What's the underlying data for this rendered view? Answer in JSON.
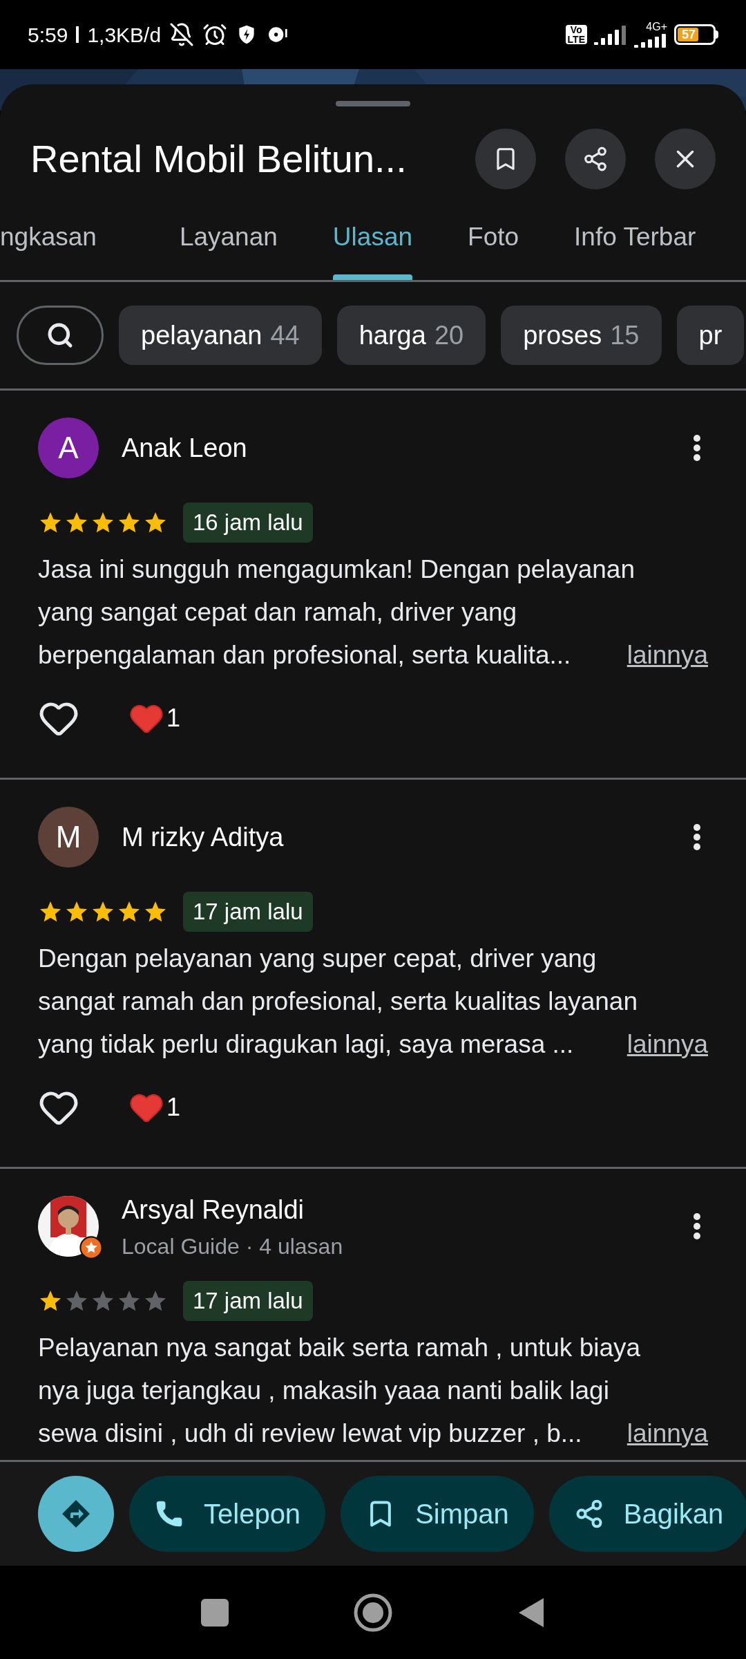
{
  "status_bar": {
    "time": "5:59",
    "speed": "1,3KB/d",
    "volte_top": "Vo",
    "volte_bottom": "LTE",
    "network": "4G+",
    "battery": "57"
  },
  "place": {
    "title": "Rental Mobil Belitun..."
  },
  "tabs": [
    {
      "label": "ngkasan",
      "selected": false
    },
    {
      "label": "Layanan",
      "selected": false
    },
    {
      "label": "Ulasan",
      "selected": true
    },
    {
      "label": "Foto",
      "selected": false
    },
    {
      "label": "Info Terbar",
      "selected": false
    }
  ],
  "filter_chips": [
    {
      "label": "pelayanan",
      "count": "44"
    },
    {
      "label": "harga",
      "count": "20"
    },
    {
      "label": "proses",
      "count": "15"
    },
    {
      "label": "pr"
    }
  ],
  "reviews": [
    {
      "avatar": {
        "kind": "letter",
        "letter": "A",
        "color": "#7b1fa2"
      },
      "name": "Anak Leon",
      "stars": 5,
      "time": "16 jam lalu",
      "lines": [
        "Jasa ini sungguh mengagumkan! Dengan pelayanan",
        "yang sangat cepat dan ramah, driver yang",
        "berpengalaman dan profesional, serta kualita..."
      ],
      "more": "lainnya",
      "reaction_count": "1"
    },
    {
      "avatar": {
        "kind": "letter",
        "letter": "M",
        "color": "#5d4037"
      },
      "name": "M rizky Aditya",
      "stars": 5,
      "time": "17 jam lalu",
      "lines": [
        "Dengan pelayanan yang super cepat, driver yang",
        "sangat ramah dan profesional, serta kualitas layanan",
        "yang tidak perlu diragukan lagi, saya merasa ..."
      ],
      "more": "lainnya",
      "reaction_count": "1"
    },
    {
      "avatar": {
        "kind": "picture",
        "local_guide": true
      },
      "name": "Arsyal Reynaldi",
      "meta": "Local Guide · 4 ulasan",
      "stars": 1,
      "time": "17 jam lalu",
      "lines": [
        "Pelayanan nya sangat baik serta ramah , untuk biaya",
        "nya juga terjangkau , makasih yaaa nanti balik lagi",
        "sewa disini , udh di review lewat vip buzzer , b..."
      ],
      "more": "lainnya"
    }
  ],
  "actions": [
    {
      "kind": "directions"
    },
    {
      "kind": "call",
      "label": "Telepon"
    },
    {
      "kind": "save",
      "label": "Simpan"
    },
    {
      "kind": "share",
      "label": "Bagikan"
    }
  ]
}
